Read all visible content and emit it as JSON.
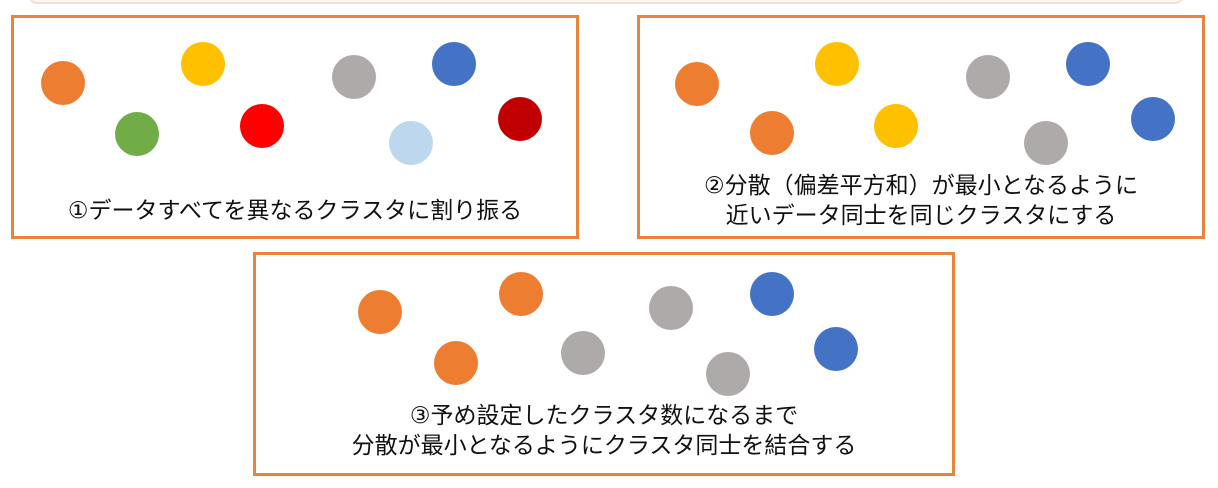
{
  "colors": {
    "border": "#e8853c",
    "orange": "#ed7d31",
    "yellow": "#ffc000",
    "green": "#70ad47",
    "red": "#ff0000",
    "gray": "#aeaaaa",
    "blue": "#4472c4",
    "light_blue": "#bdd7ee",
    "dark_red": "#c00000"
  },
  "panels": {
    "step1": {
      "caption_line1": "①データすべてを異なるクラスタに割り振る",
      "dots": [
        "orange",
        "yellow",
        "green",
        "red",
        "gray",
        "light_blue",
        "blue",
        "dark_red"
      ]
    },
    "step2": {
      "caption_line1": "②分散（偏差平方和）が最小となるように",
      "caption_line2": "近いデータ同士を同じクラスタにする",
      "dots": [
        "orange",
        "orange",
        "yellow",
        "yellow",
        "gray",
        "gray",
        "blue",
        "blue"
      ]
    },
    "step3": {
      "caption_line1": "③予め設定したクラスタ数になるまで",
      "caption_line2": "分散が最小となるようにクラスタ同士を結合する",
      "dots": [
        "orange",
        "orange",
        "orange",
        "gray",
        "gray",
        "gray",
        "blue",
        "blue"
      ]
    }
  }
}
